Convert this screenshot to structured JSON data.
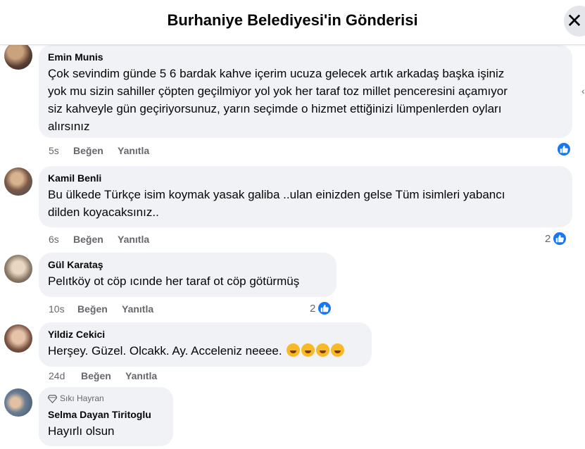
{
  "header": {
    "title": "Burhaniye Belediyesi'in Gönderisi"
  },
  "comments": [
    {
      "author": "Emin Munis",
      "text_lines": [
        "Çok sevindim günde 5 6 bardak kahve içerim ucuza gelecek artık arkadaş başka işiniz",
        "yok mu sizin sahiller çöpten geçilmiyor yol yok her taraf toz millet penceresini açamıyor",
        "siz kahveyle gün geçiriyorsunuz, yarın seçimde o hizmet ettiğinizi lümpenlerden oyları",
        "alırsınız"
      ],
      "time": "5s",
      "like": "Beğen",
      "reply": "Yanıtla",
      "reaction_count": ""
    },
    {
      "author": "Kamil Benli",
      "text_lines": [
        "Bu ülkede Türkçe isim koymak yasak galiba ..ulan einizden gelse Tüm isimleri yabancı",
        "dilden koyacaksınız.."
      ],
      "time": "6s",
      "like": "Beğen",
      "reply": "Yanıtla",
      "reaction_count": "2"
    },
    {
      "author": "Gül Karataş",
      "text_lines": [
        "Pelıtköy ot cöp ıcınde her taraf ot cöp götürmüş"
      ],
      "time": "10s",
      "like": "Beğen",
      "reply": "Yanıtla",
      "reaction_count": "2"
    },
    {
      "author": "Yildiz Cekici",
      "text_lines": [
        "Herşey. Güzel. Olcakk. Ay. Acceleniz neeee."
      ],
      "time": "24d",
      "like": "Beğen",
      "reply": "Yanıtla",
      "reaction_count": ""
    },
    {
      "badge": "Sıkı Hayran",
      "author": "Selma Dayan Tiritoglu",
      "text_lines": [
        "Hayırlı olsun"
      ]
    }
  ],
  "icons": {
    "close": "close-icon",
    "like_reaction": "like-icon",
    "laugh_emoji": "laughing-emoji-icon",
    "diamond": "diamond-icon"
  },
  "colors": {
    "accent": "#1877f2",
    "bubble": "#f0f2f5",
    "secondary_text": "#65676b"
  }
}
